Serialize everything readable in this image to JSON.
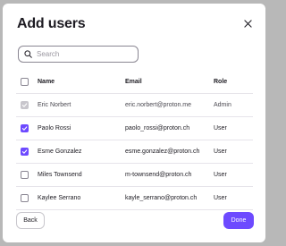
{
  "modal": {
    "title": "Add users",
    "close_icon": "close-icon"
  },
  "search": {
    "placeholder": "Search",
    "value": "",
    "icon": "search-icon"
  },
  "table": {
    "headers": {
      "name": "Name",
      "email": "Email",
      "role": "Role"
    },
    "rows": [
      {
        "name": "Eric Norbert",
        "email": "eric.norbert@proton.me",
        "role": "Admin",
        "state": "disabled"
      },
      {
        "name": "Paolo Rossi",
        "email": "paolo_rossi@proton.ch",
        "role": "User",
        "state": "checked"
      },
      {
        "name": "Esme Gonzalez",
        "email": "esme.gonzalez@proton.ch",
        "role": "User",
        "state": "checked"
      },
      {
        "name": "Miles Townsend",
        "email": "m-townsend@proton.ch",
        "role": "User",
        "state": "unchecked"
      },
      {
        "name": "Kaylee Serrano",
        "email": "kayle_serrano@proton.ch",
        "role": "User",
        "state": "unchecked"
      }
    ]
  },
  "footer": {
    "back_label": "Back",
    "done_label": "Done"
  },
  "colors": {
    "accent": "#6d4aff",
    "disabled_check": "#c8c6cc"
  }
}
